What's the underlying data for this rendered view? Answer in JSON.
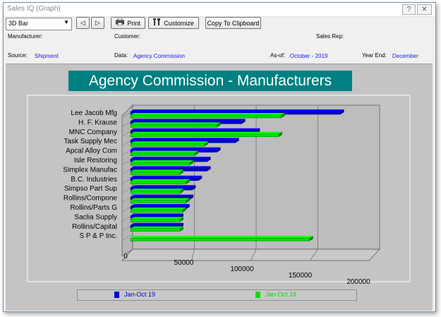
{
  "window": {
    "title": "Sales IQ (Graph)",
    "help_glyph": "?",
    "close_glyph": "✕"
  },
  "toolbar": {
    "chart_type": "3D Bar",
    "dropdown_glyph": "▼",
    "prev_glyph": "◁",
    "next_glyph": "▷",
    "print_label": "Print",
    "print_icon": "printer-icon",
    "customize_label": "Customize",
    "customize_icon": "tools-icon",
    "copy_label": "Copy To Clipboard"
  },
  "info": {
    "manufacturer_label": "Manufacturer:",
    "customer_label": "Customer:",
    "sales_rep_label": "Sales Rep:",
    "source_label": "Source:",
    "source_value": "Shipment",
    "data_label": "Data:",
    "data_value": "Agency Commission",
    "as_of_label": "As-of:",
    "as_of_value": "October - 2019",
    "year_end_label": "Year End:",
    "year_end_value": "December"
  },
  "chart_data": {
    "type": "bar",
    "orientation": "horizontal",
    "style": "3D",
    "title": "Agency Commission - Manufacturers",
    "categories": [
      "Lee Jacob Mfg",
      "H. F. Krause",
      "MNC Company",
      "Task Supply Mec",
      "Apcal Alloy Com",
      "Isle Restoring",
      "Simplex Manufac",
      "B.C. Industries",
      "Simpso Part Sup",
      "Rollins/Compone",
      "Rollins/Parts G",
      "Saclia Supply",
      "Rollins/Capital",
      "S P & P Inc."
    ],
    "series": [
      {
        "name": "Jan-Oct 19",
        "color": "#0000d0",
        "values": [
          170000,
          90000,
          102000,
          85000,
          70000,
          62000,
          62000,
          55000,
          50000,
          48000,
          45000,
          40000,
          40000,
          0
        ]
      },
      {
        "name": "Jan-Oct 18",
        "color": "#00e000",
        "values": [
          122000,
          70000,
          120000,
          60000,
          52000,
          48000,
          40000,
          45000,
          40000,
          45000,
          42000,
          40000,
          40000,
          145000
        ]
      }
    ],
    "x_ticks": [
      "0",
      "50000",
      "100000",
      "150000",
      "200000"
    ],
    "xlim": [
      0,
      200000
    ],
    "grid": true,
    "legend_position": "bottom"
  }
}
